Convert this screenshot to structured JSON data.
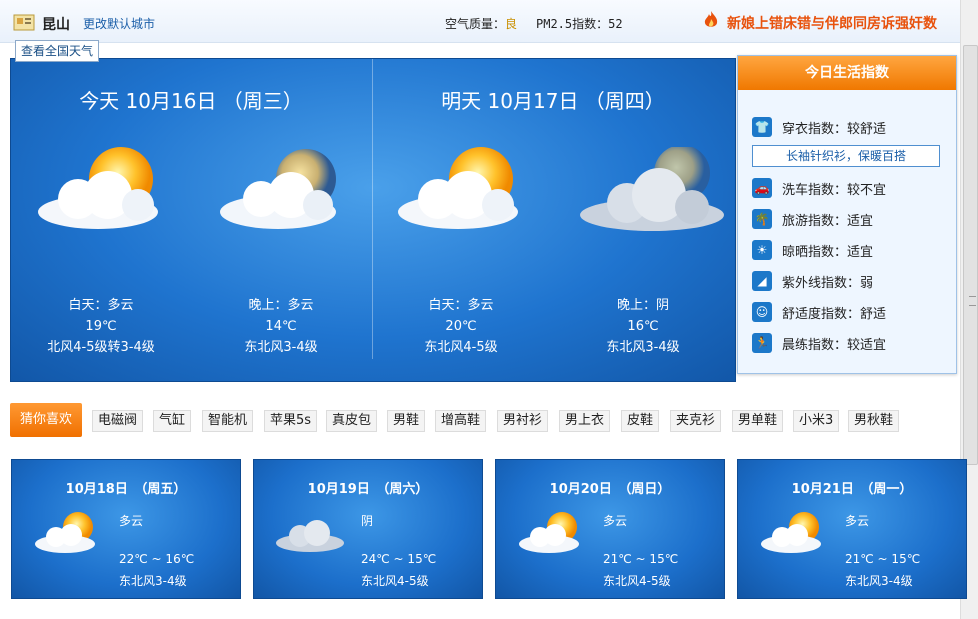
{
  "header": {
    "city": "昆山",
    "change_city": "更改默认城市",
    "national": "查看全国天气",
    "air_quality_label": "空气质量：",
    "air_quality_value": "良",
    "pm25": "PM2.5指数：52",
    "news": "新娘上错床错与伴郎同房诉强奸数"
  },
  "today": {
    "title": "今天 10月16日 （周三）",
    "day": {
      "label": "白天：多云",
      "temp": "19℃",
      "wind": "北风4-5级转3-4级"
    },
    "night": {
      "label": "晚上：多云",
      "temp": "14℃",
      "wind": "东北风3-4级"
    }
  },
  "tomorrow": {
    "title": "明天 10月17日 （周四）",
    "day": {
      "label": "白天：多云",
      "temp": "20℃",
      "wind": "东北风4-5级"
    },
    "night": {
      "label": "晚上：阴",
      "temp": "16℃",
      "wind": "东北风3-4级"
    }
  },
  "life_index": {
    "title": "今日生活指数",
    "tip": "长袖针织衫，保暖百搭",
    "items": [
      {
        "label": "穿衣指数：较舒适",
        "icon": "shirt-icon"
      },
      {
        "label": "洗车指数：较不宜",
        "icon": "car-icon"
      },
      {
        "label": "旅游指数：适宜",
        "icon": "palm-tree-icon"
      },
      {
        "label": "晾晒指数：适宜",
        "icon": "sun-icon"
      },
      {
        "label": "紫外线指数：弱",
        "icon": "uv-icon"
      },
      {
        "label": "舒适度指数：舒适",
        "icon": "smiley-icon"
      },
      {
        "label": "晨练指数：较适宜",
        "icon": "runner-icon"
      }
    ]
  },
  "guess": {
    "title": "猜你喜欢",
    "tags": [
      "电磁阀",
      "气缸",
      "智能机",
      "苹果5s",
      "真皮包",
      "男鞋",
      "增高鞋",
      "男衬衫",
      "男上衣",
      "皮鞋",
      "夹克衫",
      "男单鞋",
      "小米3",
      "男秋鞋"
    ]
  },
  "forecast": [
    {
      "date": "10月18日　（周五）",
      "desc": "多云",
      "temp": "22℃ ~ 16℃",
      "wind": "东北风3-4级",
      "icon": "partly-cloudy-icon"
    },
    {
      "date": "10月19日　（周六）",
      "desc": "阴",
      "temp": "24℃ ~ 15℃",
      "wind": "东北风4-5级",
      "icon": "overcast-icon"
    },
    {
      "date": "10月20日　（周日）",
      "desc": "多云",
      "temp": "21℃ ~ 15℃",
      "wind": "东北风4-5级",
      "icon": "partly-cloudy-icon"
    },
    {
      "date": "10月21日　（周一）",
      "desc": "多云",
      "temp": "21℃ ~ 15℃",
      "wind": "东北风3-4级",
      "icon": "partly-cloudy-icon"
    }
  ],
  "colors": {
    "accent": "#f07800",
    "sky": "#1f74cf",
    "link": "#1a5ea8"
  }
}
